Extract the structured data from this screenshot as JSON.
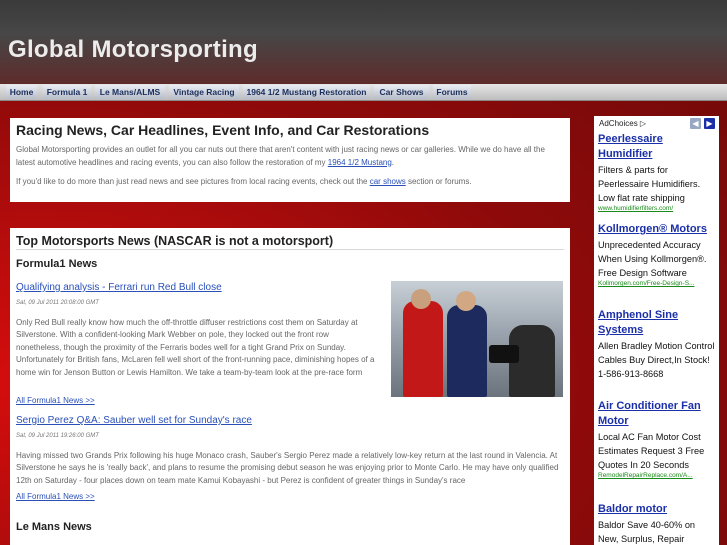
{
  "site": {
    "title": "Global Motorsporting"
  },
  "nav": {
    "items": [
      {
        "label": "Home"
      },
      {
        "label": "Formula 1"
      },
      {
        "label": "Le Mans/ALMS"
      },
      {
        "label": "Vintage Racing"
      },
      {
        "label": "1964 1/2 Mustang Restoration"
      },
      {
        "label": "Car Shows"
      },
      {
        "label": "Forums"
      }
    ]
  },
  "intro": {
    "heading": "Racing News, Car Headlines, Event Info, and Car Restorations",
    "p1_text": "Global Motorsporting provides an outlet for all you car nuts out there that aren't content with just racing news or car galleries. While we do have all the latest automotive headlines and racing events, you can also follow the restoration of my",
    "p1_link": "1964 1/2 Mustang",
    "p1_end": ".",
    "p2_text": "If you'd like to do more than just read news and see pictures from local racing events, check out the",
    "p2_link": "car shows",
    "p2_end": "section or forums."
  },
  "news": {
    "heading": "Top Motorsports News (NASCAR is not a motorsport)",
    "section1": "Formula1 News",
    "articles": [
      {
        "headline": "Qualifying analysis - Ferrari run Red Bull close",
        "date": "Sat, 09 Jul 2011 20:08:00 GMT",
        "body": "Only Red Bull really know how much the off-throttle diffuser restrictions cost them on Saturday at Silverstone. With a confident-looking Mark Webber on pole, they locked out the front row nonetheless, though the proximity of the Ferraris bodes well for a tight Grand Prix on Sunday. Unfortunately for British fans, McLaren fell well short of the front-running pace, diminishing hopes of a home win for Jenson Button or Lewis Hamilton. We take a team-by-team look at the pre-race form",
        "more": "All Formula1 News >>"
      },
      {
        "headline": "Sergio Perez Q&A: Sauber well set for Sunday's race",
        "date": "Sat, 09 Jul 2011 19:26:00 GMT",
        "body": "Having missed two Grands Prix following his huge Monaco crash, Sauber's Sergio Perez made a relatively low-key return at the last round in Valencia. At Silverstone he says he is 'really back', and plans to resume the promising debut season he was enjoying prior to Monte Carlo. He may have only qualified 12th on Saturday - four places down on team mate Kamui Kobayashi - but Perez is confident of greater things in Sunday's race",
        "more": "All Formula1 News >>"
      }
    ],
    "section2": "Le Mans News"
  },
  "ads": {
    "choices": "AdChoices",
    "items": [
      {
        "title": "Peerlessaire Humidifier",
        "text": "Filters & parts for Peerlessaire Humidifiers. Low flat rate shipping",
        "url": "www.humidifierfilters.com/"
      },
      {
        "title": "Kollmorgen® Motors",
        "text": "Unprecedented Accuracy When Using Kollmorgen®. Free Design Software",
        "url": "Kollmorgen.com/Free-Design-S..."
      },
      {
        "title": "Amphenol Sine Systems",
        "text": "Allen Bradley Motion Control Cables Buy Direct,In Stock! 1-586-913-8668",
        "url": ""
      },
      {
        "title": "Air Conditioner Fan Motor",
        "text": "Local AC Fan Motor Cost Estimates Request 3 Free Quotes In 20 Seconds",
        "url": "RemodelRepairReplace.com/A..."
      },
      {
        "title": "Baldor motor",
        "text": "Baldor Save 40-60% on New, Surplus, Repair",
        "url": ""
      }
    ]
  },
  "colors": {
    "link": "#2a50b8",
    "ad_title": "#1b2fa8",
    "ad_url": "#1a8a1a",
    "background": "#b80c0c"
  }
}
